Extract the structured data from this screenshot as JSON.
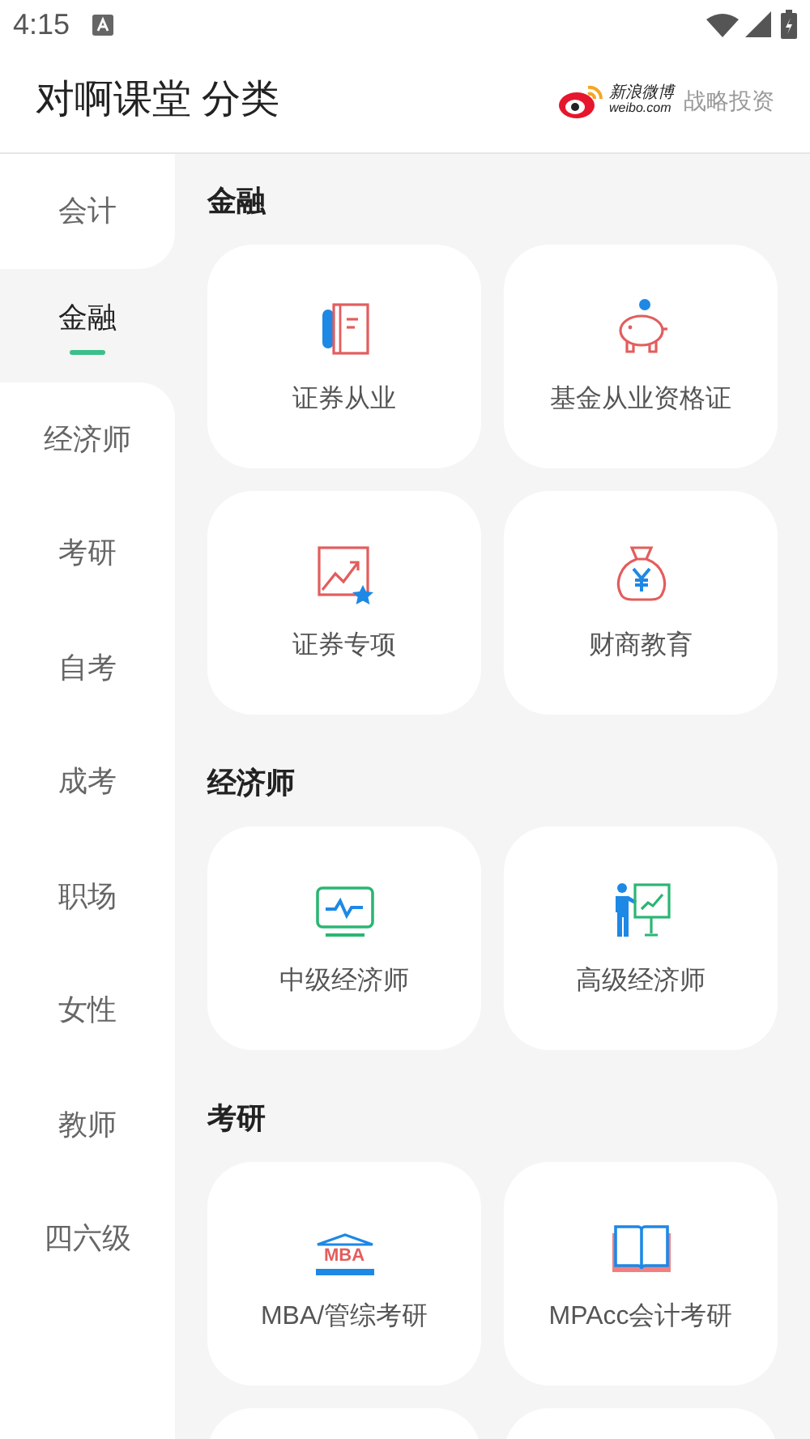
{
  "status_bar": {
    "time": "4:15"
  },
  "header": {
    "title": "对啊课堂 分类",
    "sponsor_name": "新浪微博",
    "sponsor_url": "weibo.com",
    "sponsor_label": "战略投资"
  },
  "sidebar": {
    "items": [
      {
        "label": "会计",
        "selected": false
      },
      {
        "label": "金融",
        "selected": true
      },
      {
        "label": "经济师",
        "selected": false
      },
      {
        "label": "考研",
        "selected": false
      },
      {
        "label": "自考",
        "selected": false
      },
      {
        "label": "成考",
        "selected": false
      },
      {
        "label": "职场",
        "selected": false
      },
      {
        "label": "女性",
        "selected": false
      },
      {
        "label": "教师",
        "selected": false
      },
      {
        "label": "四六级",
        "selected": false
      }
    ]
  },
  "sections": [
    {
      "title": "金融",
      "cards": [
        {
          "label": "证券从业",
          "kind": "notebook"
        },
        {
          "label": "基金从业资格证",
          "kind": "piggy"
        },
        {
          "label": "证券专项",
          "kind": "chart"
        },
        {
          "label": "财商教育",
          "kind": "moneybag"
        }
      ]
    },
    {
      "title": "经济师",
      "cards": [
        {
          "label": "中级经济师",
          "kind": "monitor"
        },
        {
          "label": "高级经济师",
          "kind": "presenter"
        }
      ]
    },
    {
      "title": "考研",
      "cards": [
        {
          "label": "MBA/管综考研",
          "kind": "mba",
          "icon_text": "MBA"
        },
        {
          "label": "MPAcc会计考研",
          "kind": "book"
        }
      ]
    }
  ]
}
